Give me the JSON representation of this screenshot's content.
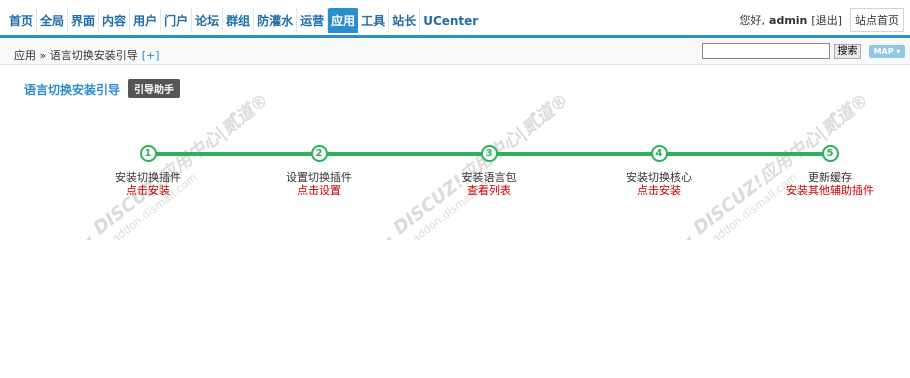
{
  "nav": {
    "items": [
      "首页",
      "全局",
      "界面",
      "内容",
      "用户",
      "门户",
      "论坛",
      "群组",
      "防灌水",
      "运营",
      "应用",
      "工具",
      "站长",
      "UCenter"
    ],
    "active_index": 10
  },
  "user": {
    "greeting": "您好,",
    "name": "admin",
    "logout": "[退出]",
    "home_button": "站点首页"
  },
  "subbar": {
    "breadcrumb": "应用 » 语言切换安装引导",
    "add_label": "[+]",
    "search_value": "",
    "search_button": "搜索",
    "map_button": "MAP ▾"
  },
  "page": {
    "title": "语言切换安装引导",
    "guide_button": "引导助手"
  },
  "steps": [
    {
      "num": "1",
      "title": "安装切换插件",
      "link": "点击安装"
    },
    {
      "num": "2",
      "title": "设置切换插件",
      "link": "点击设置"
    },
    {
      "num": "3",
      "title": "安装语言包",
      "link": "查看列表"
    },
    {
      "num": "4",
      "title": "安装切换核心",
      "link": "点击安装"
    },
    {
      "num": "5",
      "title": "更新缓存",
      "link": "安装其他辅助插件"
    }
  ],
  "watermark": {
    "brand": "DISCUZ!应用中心|贰道®",
    "url": "addon.dismall.com"
  },
  "colors": {
    "accent": "#2b8dd0",
    "step_green": "#2db15a",
    "link_red": "#cc0000"
  }
}
